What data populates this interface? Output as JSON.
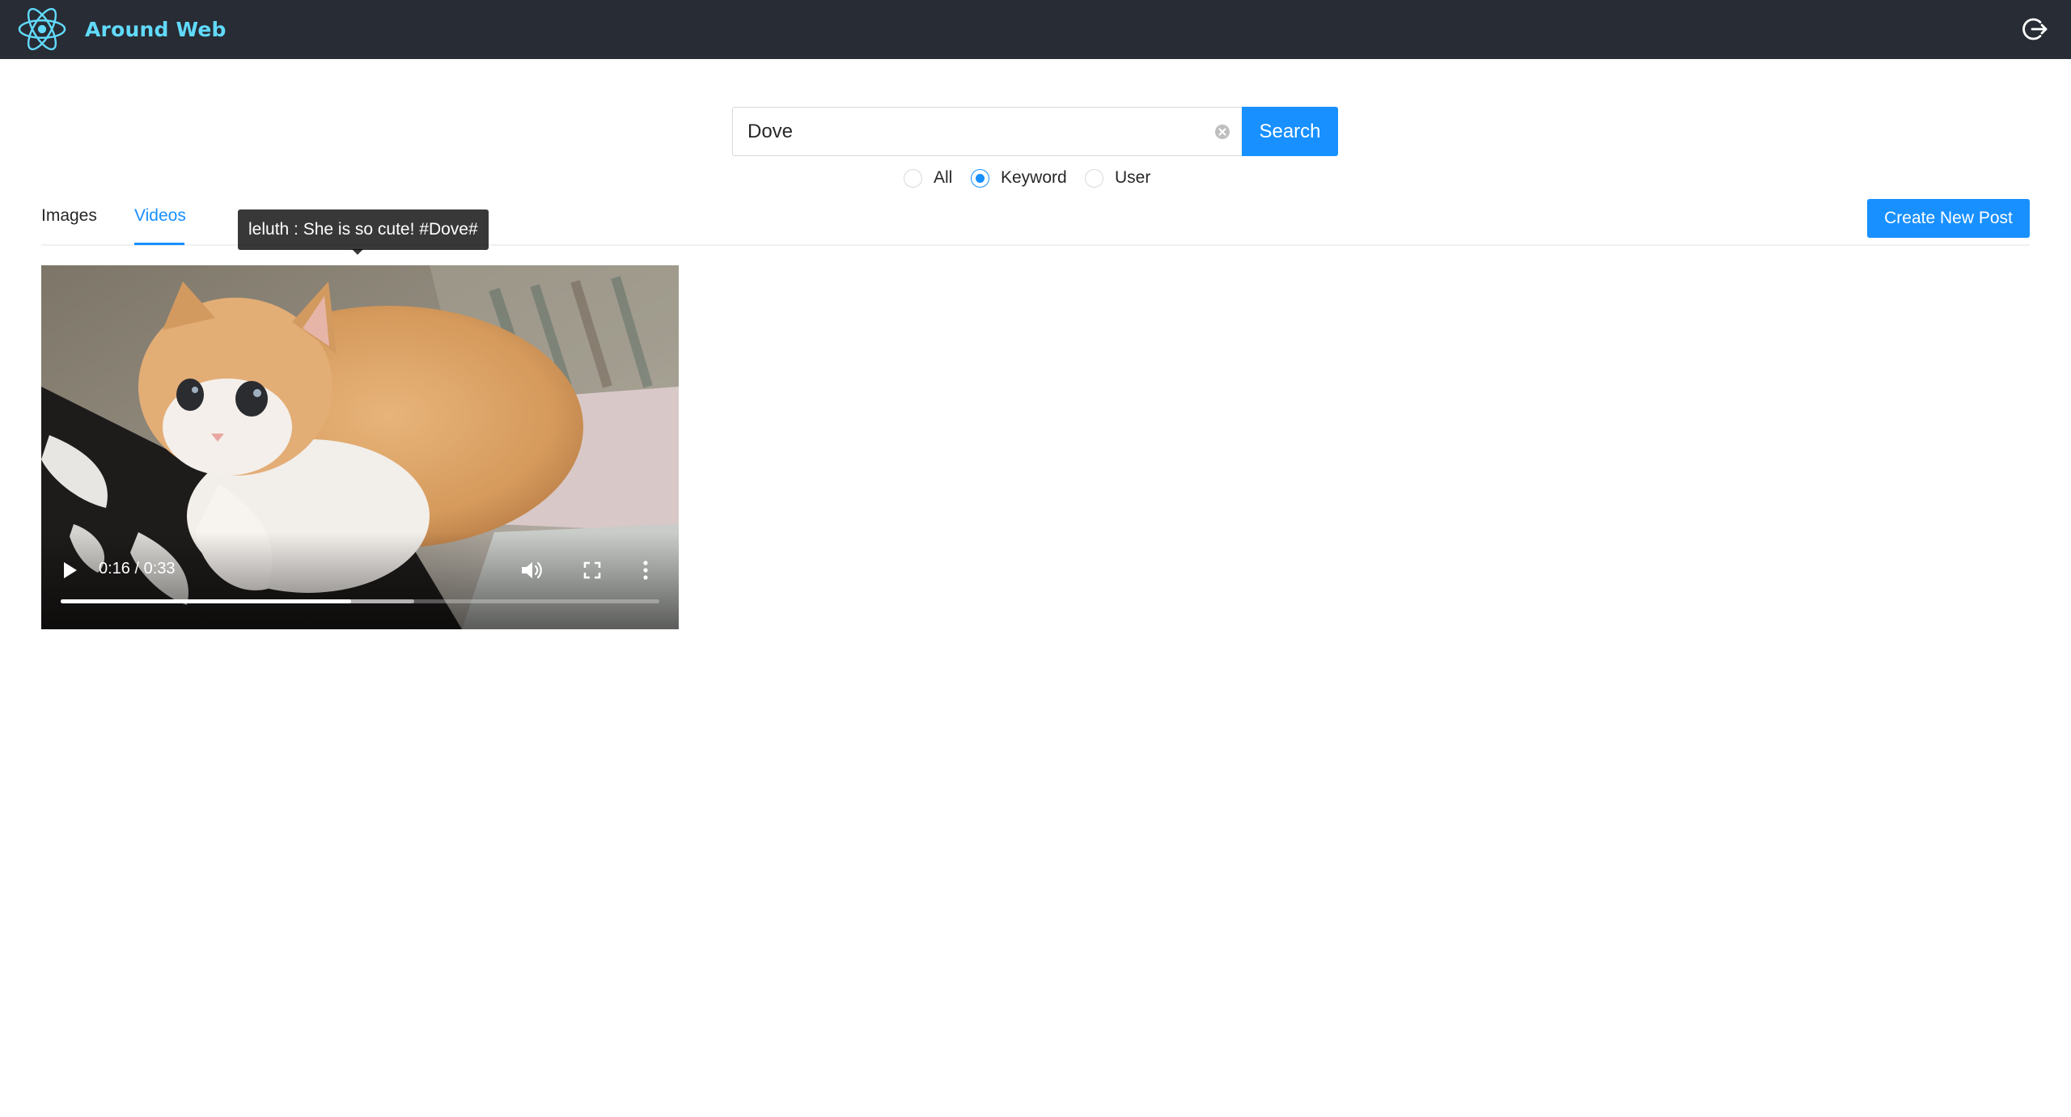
{
  "header": {
    "title": "Around Web",
    "logo_icon": "react-atom-icon",
    "logout_icon": "logout-icon",
    "bg_color": "#282c34",
    "accent_color": "#61dafb"
  },
  "search": {
    "value": "Dove",
    "button_label": "Search",
    "clear_icon": "close-circle-icon",
    "options": [
      {
        "label": "All",
        "checked": false
      },
      {
        "label": "Keyword",
        "checked": true
      },
      {
        "label": "User",
        "checked": false
      }
    ]
  },
  "tabs": {
    "items": [
      {
        "label": "Images",
        "active": false
      },
      {
        "label": "Videos",
        "active": true
      }
    ]
  },
  "create_post": {
    "label": "Create New Post"
  },
  "video": {
    "time": "0:16 / 0:33",
    "progress": 0.485,
    "buffered": 0.59,
    "tooltip": "leluth : She is so cute! #Dove#"
  },
  "colors": {
    "primary": "#1890ff"
  }
}
